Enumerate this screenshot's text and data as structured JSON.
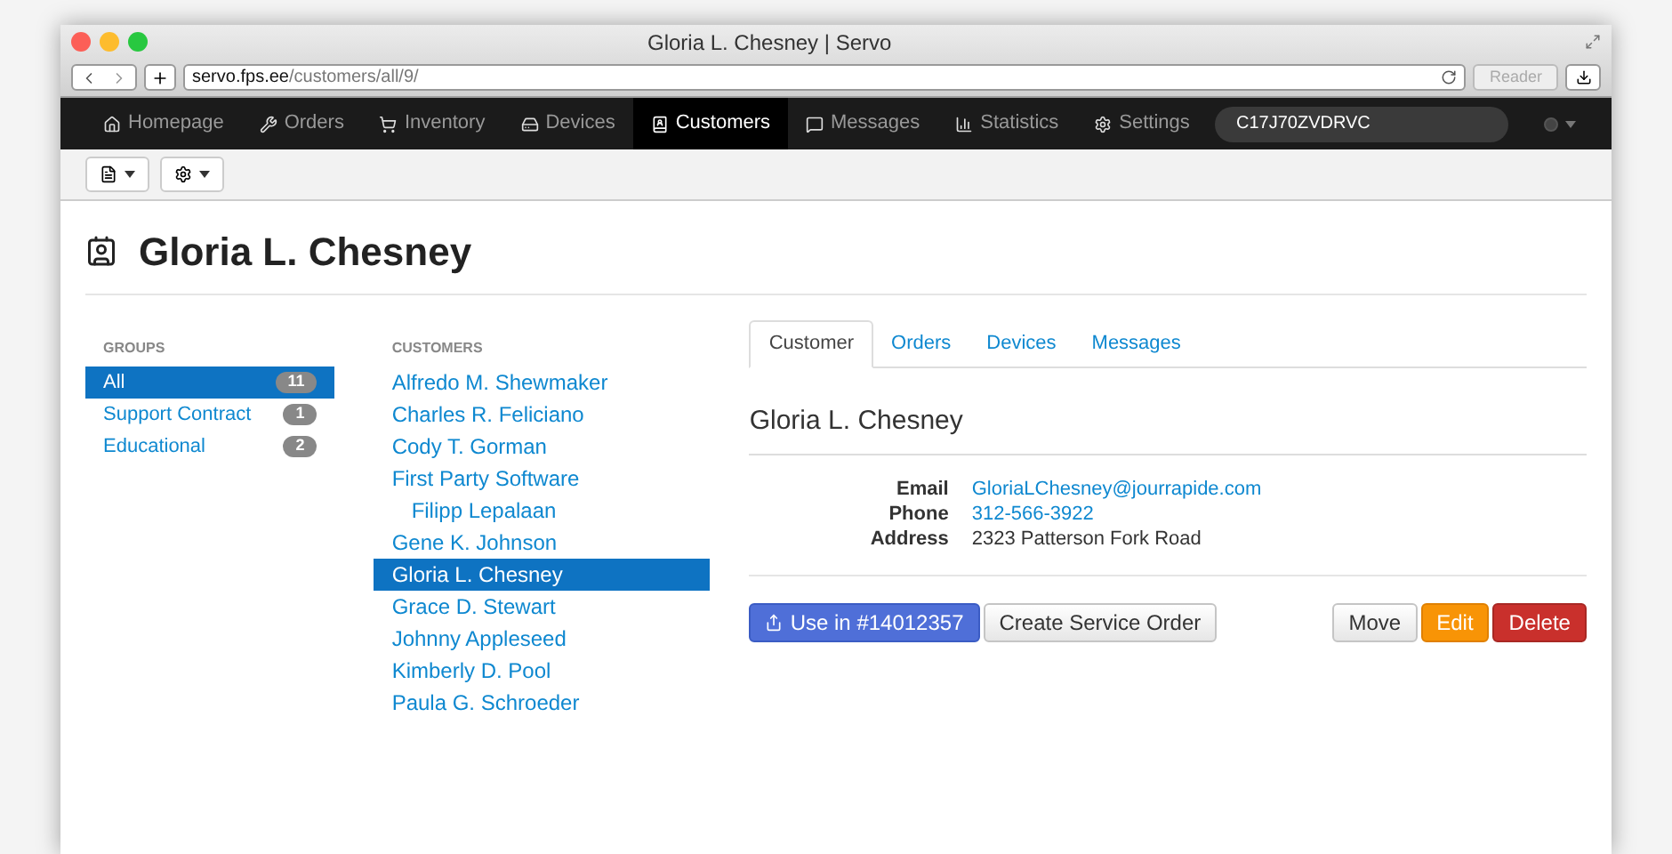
{
  "window": {
    "title": "Gloria L. Chesney | Servo"
  },
  "browser": {
    "url_host": "servo.fps.ee",
    "url_path": "/customers/all/9/",
    "reader": "Reader"
  },
  "navbar": {
    "items": [
      {
        "label": "Homepage",
        "kind": "home",
        "selected": false
      },
      {
        "label": "Orders",
        "kind": "wrench",
        "selected": false
      },
      {
        "label": "Inventory",
        "kind": "cart",
        "selected": false
      },
      {
        "label": "Devices",
        "kind": "drive",
        "selected": false
      },
      {
        "label": "Customers",
        "kind": "book",
        "selected": true
      },
      {
        "label": "Messages",
        "kind": "chat",
        "selected": false
      },
      {
        "label": "Statistics",
        "kind": "signal",
        "selected": false
      },
      {
        "label": "Settings",
        "kind": "gear",
        "selected": false
      }
    ],
    "search_value": "C17J70ZVDRVC"
  },
  "page": {
    "title": "Gloria L. Chesney"
  },
  "groups": {
    "heading": "GROUPS",
    "items": [
      {
        "label": "All",
        "count": "11",
        "selected": true
      },
      {
        "label": "Support Contract",
        "count": "1",
        "selected": false
      },
      {
        "label": "Educational",
        "count": "2",
        "selected": false
      }
    ]
  },
  "customers": {
    "heading": "CUSTOMERS",
    "items": [
      {
        "name": "Alfredo M. Shewmaker",
        "selected": false
      },
      {
        "name": "Charles R. Feliciano",
        "selected": false
      },
      {
        "name": "Cody T. Gorman",
        "selected": false
      },
      {
        "name": "First Party Software",
        "selected": false,
        "children": [
          {
            "name": "Filipp Lepalaan",
            "selected": false
          }
        ]
      },
      {
        "name": "Gene K. Johnson",
        "selected": false
      },
      {
        "name": "Gloria L. Chesney",
        "selected": true
      },
      {
        "name": "Grace D. Stewart",
        "selected": false
      },
      {
        "name": "Johnny Appleseed",
        "selected": false
      },
      {
        "name": "Kimberly D. Pool",
        "selected": false
      },
      {
        "name": "Paula G. Schroeder",
        "selected": false
      }
    ]
  },
  "tabs": [
    {
      "label": "Customer",
      "selected": true
    },
    {
      "label": "Orders",
      "selected": false
    },
    {
      "label": "Devices",
      "selected": false
    },
    {
      "label": "Messages",
      "selected": false
    }
  ],
  "detail": {
    "name": "Gloria L. Chesney",
    "fields": [
      {
        "label": "Email",
        "value": "GloriaLChesney@jourrapide.com",
        "kind": "link"
      },
      {
        "label": "Phone",
        "value": "312-566-3922",
        "kind": "link"
      },
      {
        "label": "Address",
        "value": "2323 Patterson Fork Road",
        "kind": "text"
      }
    ]
  },
  "actions": {
    "left": [
      {
        "label": "Use in #14012357",
        "kind": "primary"
      },
      {
        "label": "Create Service Order",
        "kind": "default"
      }
    ],
    "right": [
      {
        "label": "Move",
        "kind": "default"
      },
      {
        "label": "Edit",
        "kind": "warning"
      },
      {
        "label": "Delete",
        "kind": "danger"
      }
    ]
  }
}
